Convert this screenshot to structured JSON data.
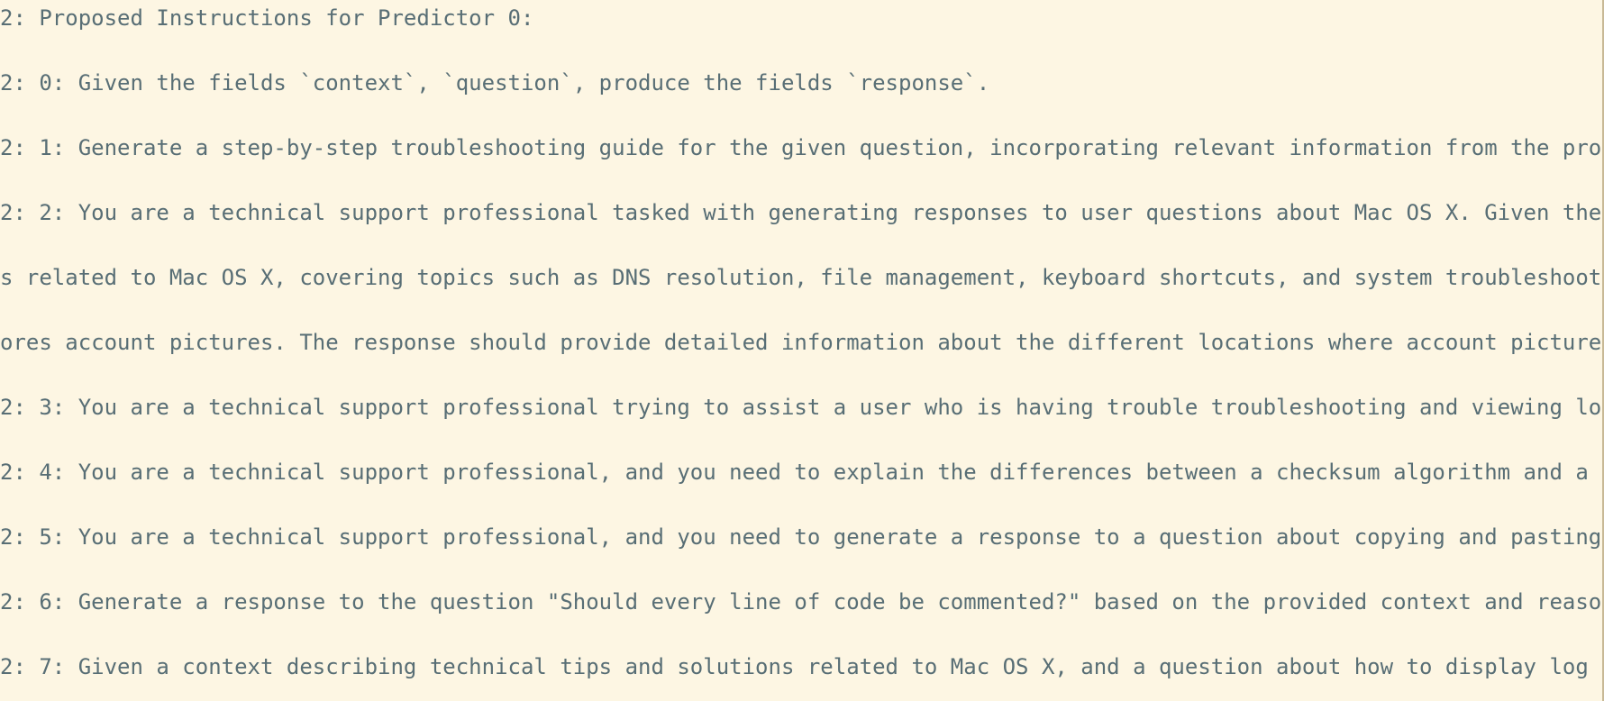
{
  "log": {
    "lines": [
      "2: Proposed Instructions for Predictor 0:",
      "2: 0: Given the fields `context`, `question`, produce the fields `response`.",
      "2: 1: Generate a step-by-step troubleshooting guide for the given question, incorporating relevant information from the pro",
      "2: 2: You are a technical support professional tasked with generating responses to user questions about Mac OS X. Given the",
      "s related to Mac OS X, covering topics such as DNS resolution, file management, keyboard shortcuts, and system troubleshoot",
      "ores account pictures. The response should provide detailed information about the different locations where account picture",
      "2: 3: You are a technical support professional trying to assist a user who is having trouble troubleshooting and viewing lo",
      "2: 4: You are a technical support professional, and you need to explain the differences between a checksum algorithm and a",
      "2: 5: You are a technical support professional, and you need to generate a response to a question about copying and pasting",
      "2: 6: Generate a response to the question \"Should every line of code be commented?\" based on the provided context and reaso",
      "2: 7: Given a context describing technical tips and solutions related to Mac OS X, and a question about how to display log"
    ]
  },
  "colors": {
    "background": "#fdf6e3",
    "text": "#586e75"
  }
}
